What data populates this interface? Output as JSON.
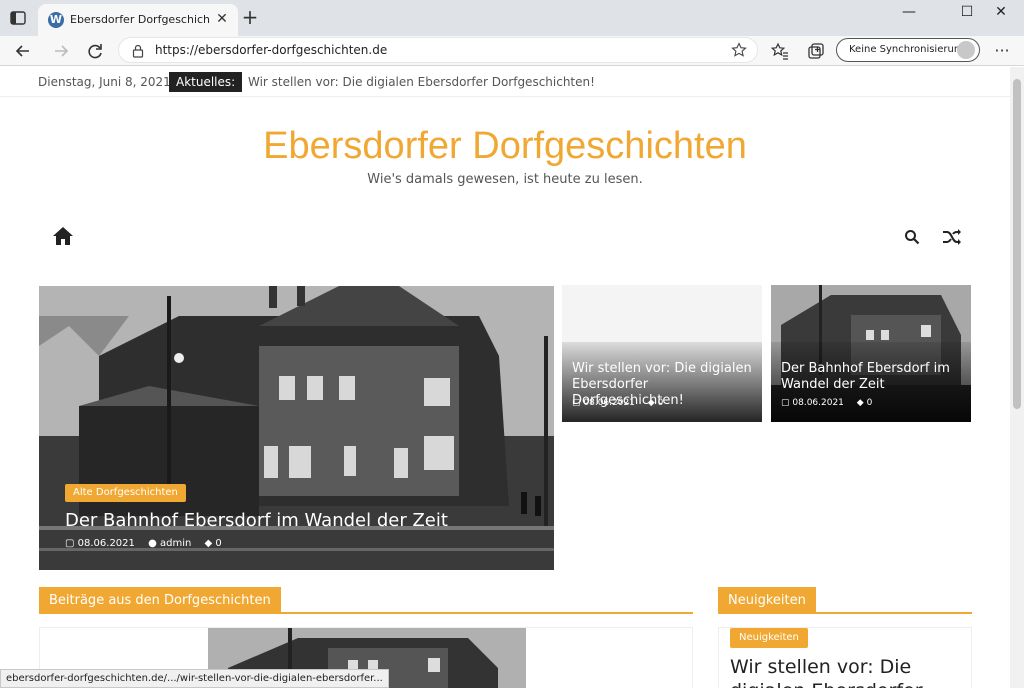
{
  "browser": {
    "tab_title": "Ebersdorfer Dorfgeschichten – W",
    "url": "https://ebersdorfer-dorfgeschichten.de",
    "sync_label": "Keine Synchronisierung",
    "icons": [
      "tab-actions-icon",
      "wordpress-icon",
      "close-icon",
      "plus-icon",
      "minimize-icon",
      "maximize-icon",
      "window-close-icon",
      "back-icon",
      "forward-icon",
      "refresh-icon",
      "lock-icon",
      "favorite-star-icon",
      "favorites-icon",
      "collections-icon",
      "more-icon"
    ]
  },
  "topbar": {
    "date": "Dienstag, Juni 8, 2021",
    "news_label": "Aktuelles:",
    "news_text": "Wir stellen vor: Die digialen Ebersdorfer Dorfgeschichten!"
  },
  "header": {
    "site_title": "Ebersdorfer Dorfgeschichten",
    "tagline": "Wie's damals gewesen, ist heute zu lesen.",
    "accent_color": "#f0a832"
  },
  "featured": {
    "main": {
      "category": "Alte Dorfgeschichten",
      "title": "Der Bahnhof Ebersdorf im Wandel der Zeit",
      "date": "08.06.2021",
      "author": "admin",
      "comments": "0"
    },
    "small": [
      {
        "title": "Wir stellen vor: Die digialen Ebersdorfer Dorfgeschichten!",
        "date": "08.06.2021",
        "comments": "0"
      },
      {
        "title": "Der Bahnhof Ebersdorf im Wandel der Zeit",
        "date": "08.06.2021",
        "comments": "0"
      }
    ]
  },
  "sections": {
    "posts_heading": "Beiträge aus den Dorfgeschichten",
    "news_heading": "Neuigkeiten",
    "news_badge": "Neuigkeiten",
    "news_title": "Wir stellen vor: Die digialen Ebersdorfer"
  },
  "status_url": "ebersdorfer-dorfgeschichten.de/.../wir-stellen-vor-die-digialen-ebersdorfer..."
}
